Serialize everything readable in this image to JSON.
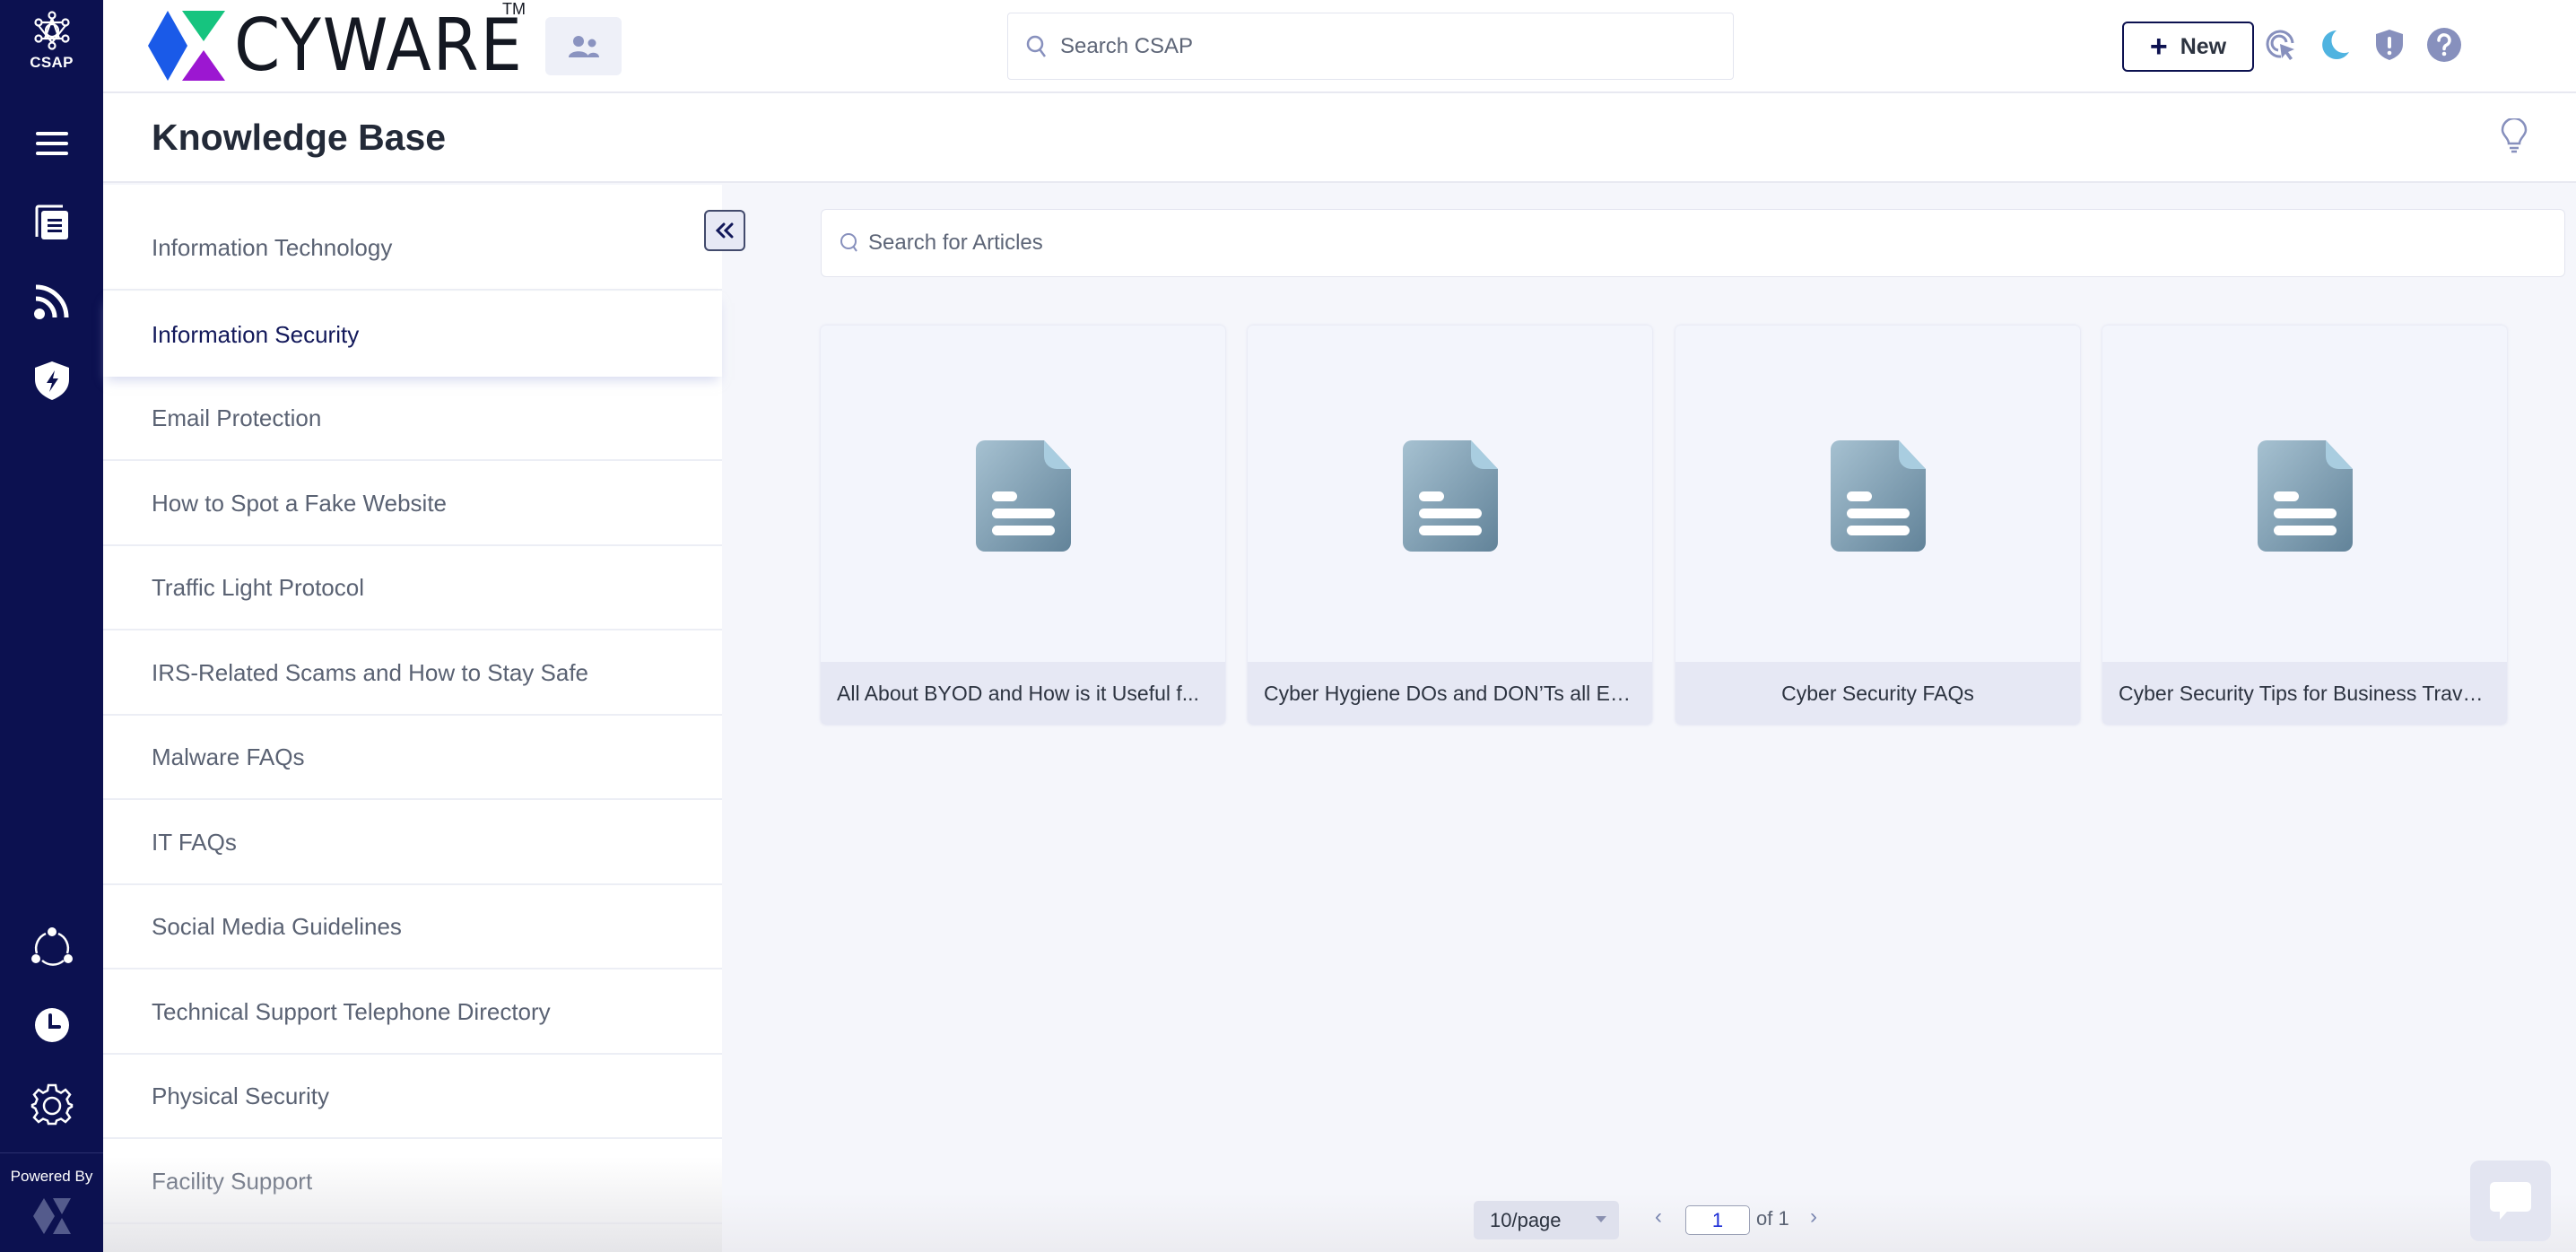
{
  "rail": {
    "brand_label": "CSAP",
    "items": [
      {
        "name": "menu",
        "icon": "hamburger-icon"
      },
      {
        "name": "articles",
        "icon": "documents-icon"
      },
      {
        "name": "feeds",
        "icon": "rss-icon"
      },
      {
        "name": "threats",
        "icon": "shield-bolt-icon"
      },
      {
        "name": "share",
        "icon": "share-nodes-icon"
      },
      {
        "name": "history",
        "icon": "clock-icon"
      },
      {
        "name": "settings",
        "icon": "gear-icon"
      }
    ],
    "powered_by": "Powered By"
  },
  "header": {
    "logo_text": "CYWARE",
    "logo_tm": "TM",
    "search_placeholder": "Search CSAP",
    "new_button": "New",
    "icons": [
      "cursor-click-icon",
      "moon-icon",
      "shield-alert-icon",
      "help-icon"
    ],
    "colors": {
      "accent": "#0c1150",
      "moon": "#4fb3e0",
      "icon_muted": "#8790bd"
    }
  },
  "page": {
    "title": "Knowledge Base"
  },
  "categories": {
    "active_index": 1,
    "items": [
      {
        "label": "Information Technology"
      },
      {
        "label": "Information Security"
      },
      {
        "label": "Email Protection"
      },
      {
        "label": "How to Spot a Fake Website"
      },
      {
        "label": "Traffic Light Protocol"
      },
      {
        "label": "IRS-Related Scams and How to Stay Safe"
      },
      {
        "label": "Malware FAQs"
      },
      {
        "label": "IT FAQs"
      },
      {
        "label": "Social Media Guidelines"
      },
      {
        "label": "Technical Support Telephone Directory"
      },
      {
        "label": "Physical Security"
      },
      {
        "label": "Facility Support"
      }
    ]
  },
  "articles": {
    "search_placeholder": "Search for Articles",
    "items": [
      {
        "title": "All About BYOD and How is it Useful f..."
      },
      {
        "title": "Cyber Hygiene DOs and DON’Ts all Em..."
      },
      {
        "title": "Cyber Security FAQs"
      },
      {
        "title": "Cyber Security Tips for Business Trave..."
      }
    ]
  },
  "pagination": {
    "per_page": "10/page",
    "current_page": "1",
    "of_label": "of 1",
    "prev": "‹",
    "next": "›"
  }
}
